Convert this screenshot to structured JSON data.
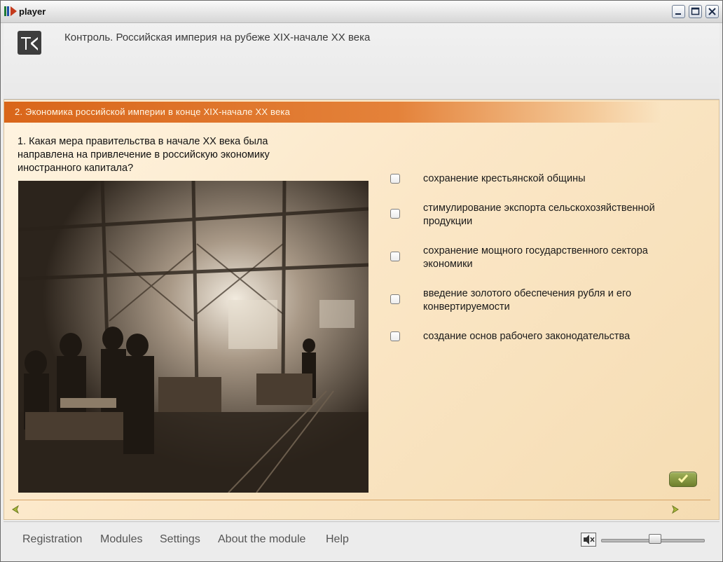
{
  "window": {
    "title": "player",
    "icon": "player-icon",
    "controls": [
      "minimize-icon",
      "maximize-icon",
      "close-icon"
    ]
  },
  "header": {
    "logo_icon": "k-logo-icon",
    "course_title": "Контроль. Российская империя на рубеже XIX-начале XX века"
  },
  "section": {
    "title": "2. Экономика российской империи в конце XIX-начале XX века"
  },
  "question": {
    "text": "1. Какая мера правительства в начале XX века была направлена на привлечение в российскую экономику иностранного капитала?",
    "image": "factory-workers-photo"
  },
  "options": [
    {
      "label": "сохранение крестьянской общины",
      "checked": false
    },
    {
      "label": "стимулирование экспорта сельскохозяйственной продукции",
      "checked": false
    },
    {
      "label": "сохранение мощного государственного сектора экономики",
      "checked": false
    },
    {
      "label": "введение золотого обеспечения рубля и его конвертируемости",
      "checked": false
    },
    {
      "label": "создание основ рабочего законодательства",
      "checked": false
    }
  ],
  "controls": {
    "submit_icon": "checkmark-icon",
    "prev_icon": "arrow-left-icon",
    "next_icon": "arrow-right-icon"
  },
  "menu": {
    "items": [
      "Registration",
      "Modules",
      "Settings",
      "About the module",
      "Help"
    ]
  },
  "audio": {
    "icon": "speaker-muted-icon",
    "volume_fraction": 0.53
  },
  "colors": {
    "section_bar": "#d9661a",
    "content_bg": "#fbe7c7",
    "accent_arrow": "#a8b83a"
  }
}
